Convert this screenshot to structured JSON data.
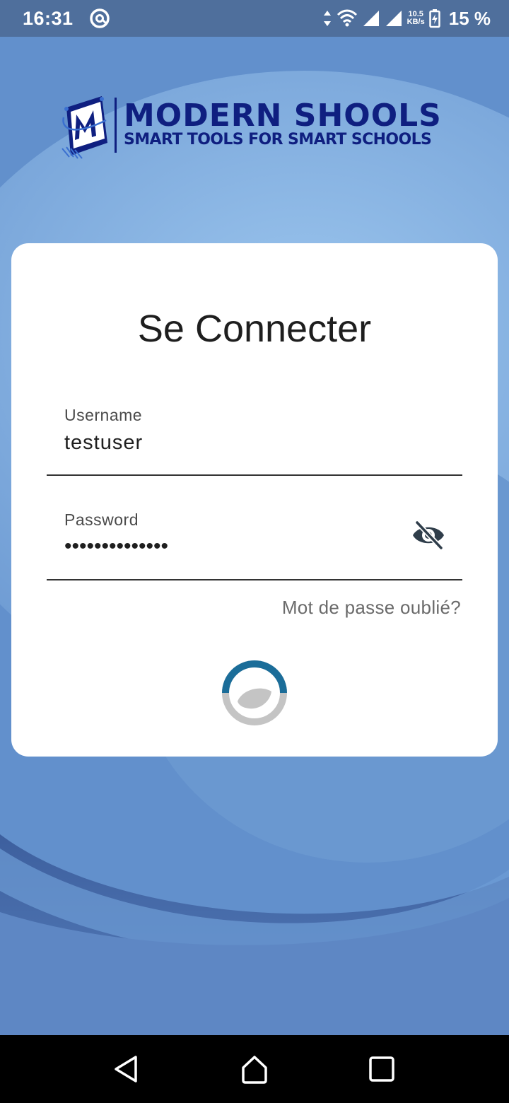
{
  "status_bar": {
    "time": "16:31",
    "app_icon": "at-sign-icon",
    "net_speed_value": "10.5",
    "net_speed_unit": "KB/s",
    "battery_text": "15 %"
  },
  "logo": {
    "title": "MODERN SHOOLS",
    "subtitle": "SMART TOOLS FOR SMART SCHOOLS",
    "brand_color": "#0f1f80"
  },
  "login": {
    "title": "Se Connecter",
    "username": {
      "label": "Username",
      "value": "testuser"
    },
    "password": {
      "label": "Password",
      "value": "••••••••••••••",
      "toggle_icon": "eye-off-icon"
    },
    "forgot_password": "Mot de passe oublié?",
    "loading_icon": "loading-spinner-icon"
  },
  "nav_bar": {
    "back_icon": "back-triangle-icon",
    "home_icon": "home-icon",
    "recents_icon": "recents-square-icon"
  },
  "colors": {
    "background": "#5f8cc8",
    "status_bar": "#4f6f9c",
    "card": "#ffffff",
    "spinner_accent": "#1b6d99",
    "spinner_track": "#c4c4c4"
  }
}
